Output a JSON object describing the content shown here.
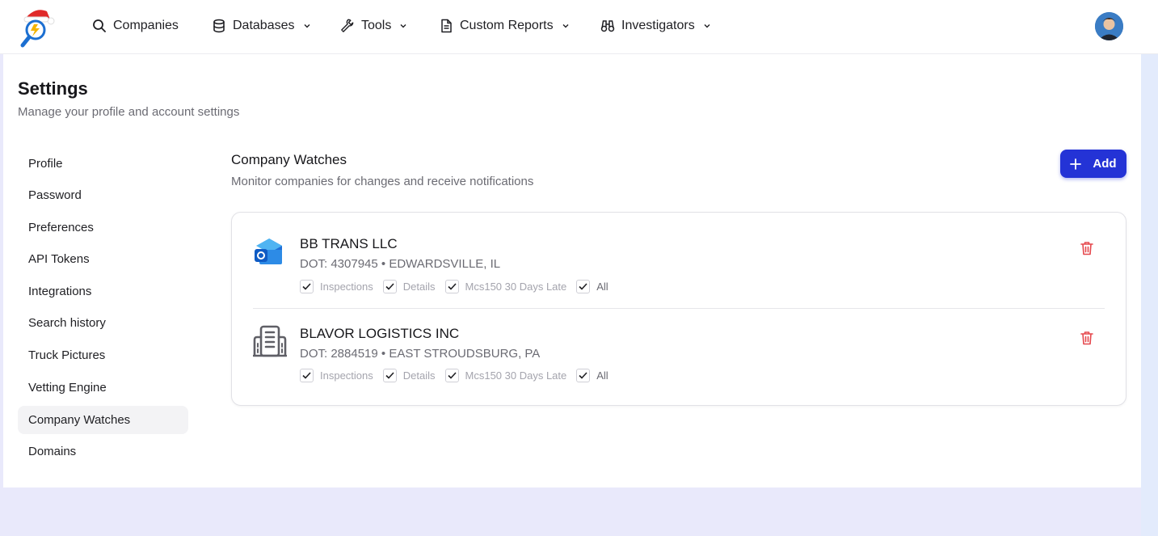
{
  "nav": {
    "items": [
      {
        "label": "Companies",
        "icon": "search-icon",
        "has_dropdown": false
      },
      {
        "label": "Databases",
        "icon": "database-icon",
        "has_dropdown": true
      },
      {
        "label": "Tools",
        "icon": "wrench-icon",
        "has_dropdown": true
      },
      {
        "label": "Custom Reports",
        "icon": "document-icon",
        "has_dropdown": true
      },
      {
        "label": "Investigators",
        "icon": "binoculars-icon",
        "has_dropdown": true
      }
    ]
  },
  "page": {
    "title": "Settings",
    "subtitle": "Manage your profile and account settings"
  },
  "sidebar": {
    "items": [
      {
        "label": "Profile"
      },
      {
        "label": "Password"
      },
      {
        "label": "Preferences"
      },
      {
        "label": "API Tokens"
      },
      {
        "label": "Integrations"
      },
      {
        "label": "Search history"
      },
      {
        "label": "Truck Pictures"
      },
      {
        "label": "Vetting Engine"
      },
      {
        "label": "Company Watches",
        "active": true
      },
      {
        "label": "Domains"
      }
    ]
  },
  "section": {
    "title": "Company Watches",
    "subtitle": "Monitor companies for changes and receive notifications",
    "add_label": "Add"
  },
  "watches": [
    {
      "name": "BB TRANS LLC",
      "meta": "DOT: 4307945 • EDWARDSVILLE, IL",
      "icon": "outlook-icon",
      "checks": [
        {
          "label": "Inspections",
          "checked": true
        },
        {
          "label": "Details",
          "checked": true
        },
        {
          "label": "Mcs150 30 Days Late",
          "checked": true
        },
        {
          "label": "All",
          "checked": true
        }
      ]
    },
    {
      "name": "BLAVOR LOGISTICS INC",
      "meta": "DOT: 2884519 • EAST STROUDSBURG, PA",
      "icon": "building-icon",
      "checks": [
        {
          "label": "Inspections",
          "checked": true
        },
        {
          "label": "Details",
          "checked": true
        },
        {
          "label": "Mcs150 30 Days Late",
          "checked": true
        },
        {
          "label": "All",
          "checked": true
        }
      ]
    }
  ],
  "colors": {
    "accent": "#2433d6",
    "danger": "#e5484d",
    "background": "#e9e9fb"
  }
}
